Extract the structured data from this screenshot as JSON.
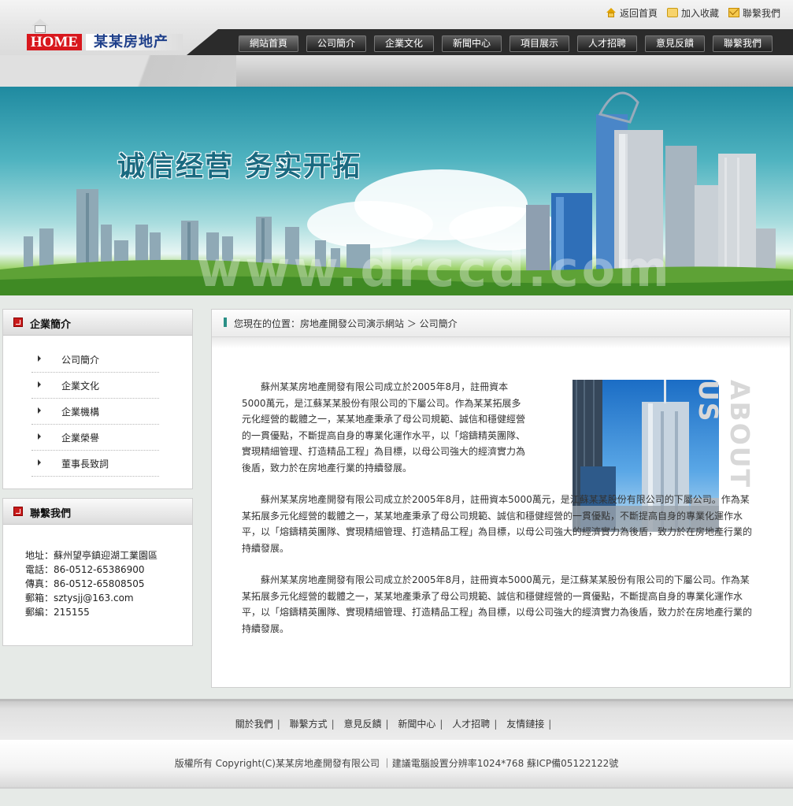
{
  "header": {
    "top_links": [
      {
        "label": "返回首頁",
        "icon": "home-icon"
      },
      {
        "label": "加入收藏",
        "icon": "favorite-icon"
      },
      {
        "label": "聯繫我們",
        "icon": "mail-icon"
      }
    ],
    "logo": {
      "home_text": "HOME",
      "company_text": "某某房地产"
    },
    "nav": [
      "網站首頁",
      "公司簡介",
      "企業文化",
      "新聞中心",
      "項目展示",
      "人才招聘",
      "意見反饋",
      "聯繫我們"
    ]
  },
  "banner": {
    "slogan": "诚信经营 务实开拓",
    "watermark": "www.drccd.com"
  },
  "sidebar": {
    "about": {
      "title": "企業簡介",
      "items": [
        "公司簡介",
        "企業文化",
        "企業機構",
        "企業榮譽",
        "董事長致詞"
      ]
    },
    "contact": {
      "title": "聯繫我們",
      "lines": [
        "地址：蘇州望亭鎮迎湖工業園區",
        "電話：86-0512-65386900",
        "傳真：86-0512-65808505",
        "郵箱：sztysjj@163.com",
        "郵編：215155"
      ]
    }
  },
  "main": {
    "breadcrumb": "您現在的位置：房地產開發公司演示網站 ＞ 公司簡介",
    "about_image_text": "ABOUT US",
    "paragraphs": [
      "蘇州某某房地產開發有限公司成立於2005年8月，註冊資本5000萬元，是江蘇某某股份有限公司的下屬公司。作為某某拓展多元化經營的載體之一，某某地產秉承了母公司規範、誠信和穩健經營的一貫優點，不斷提高自身的專業化運作水平，以「熔鑄精英團隊、實現精細管理、打造精品工程」為目標，以母公司強大的經濟實力為後盾，致力於在房地產行業的持續發展。",
      "蘇州某某房地產開發有限公司成立於2005年8月，註冊資本5000萬元，是江蘇某某股份有限公司的下屬公司。作為某某拓展多元化經營的載體之一，某某地產秉承了母公司規範、誠信和穩健經營的一貫優點，不斷提高自身的專業化運作水平，以「熔鑄精英團隊、實現精細管理、打造精品工程」為目標，以母公司強大的經濟實力為後盾，致力於在房地產行業的持續發展。",
      "蘇州某某房地產開發有限公司成立於2005年8月，註冊資本5000萬元，是江蘇某某股份有限公司的下屬公司。作為某某拓展多元化經營的載體之一，某某地產秉承了母公司規範、誠信和穩健經營的一貫優點，不斷提高自身的專業化運作水平，以「熔鑄精英團隊、實現精細管理、打造精品工程」為目標，以母公司強大的經濟實力為後盾，致力於在房地產行業的持續發展。"
    ]
  },
  "footer": {
    "links": [
      "關於我們",
      "聯繫方式",
      "意見反饋",
      "新聞中心",
      "人才招聘",
      "友情鏈接"
    ],
    "copyright": "版權所有 Copyright(C)某某房地產開發有限公司 ｜建議電腦設置分辨率1024*768 蘇ICP備05122122號"
  }
}
